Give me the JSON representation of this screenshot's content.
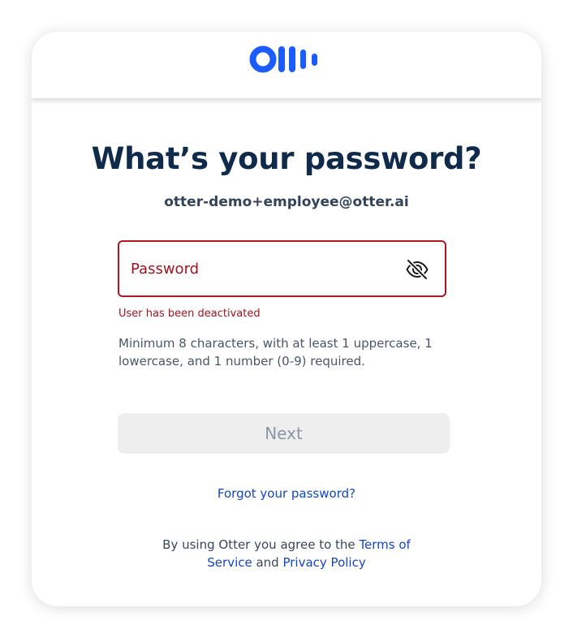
{
  "brand": {
    "name": "Otter",
    "logo_icon": "otter-logo-icon",
    "color": "#1a5cff"
  },
  "form": {
    "title": "What’s your password?",
    "email": "otter-demo+employee@otter.ai",
    "password": {
      "placeholder": "Password",
      "value": "",
      "toggle_icon": "eye-slash-icon"
    },
    "error": "User has been deactivated",
    "hint": "Minimum 8 characters, with at least 1 uppercase, 1 lowercase, and 1 number (0-9) required.",
    "next_label": "Next",
    "forgot_label": "Forgot your password?"
  },
  "legal": {
    "prefix": "By using Otter you agree to the ",
    "terms_label": "Terms of Service",
    "middle": " and ",
    "privacy_label": "Privacy Policy"
  },
  "colors": {
    "error": "#b4141f",
    "link": "#1246c8",
    "title": "#0f2a4a",
    "button_disabled_bg": "#eeeeee",
    "button_disabled_text": "#8797a6"
  }
}
